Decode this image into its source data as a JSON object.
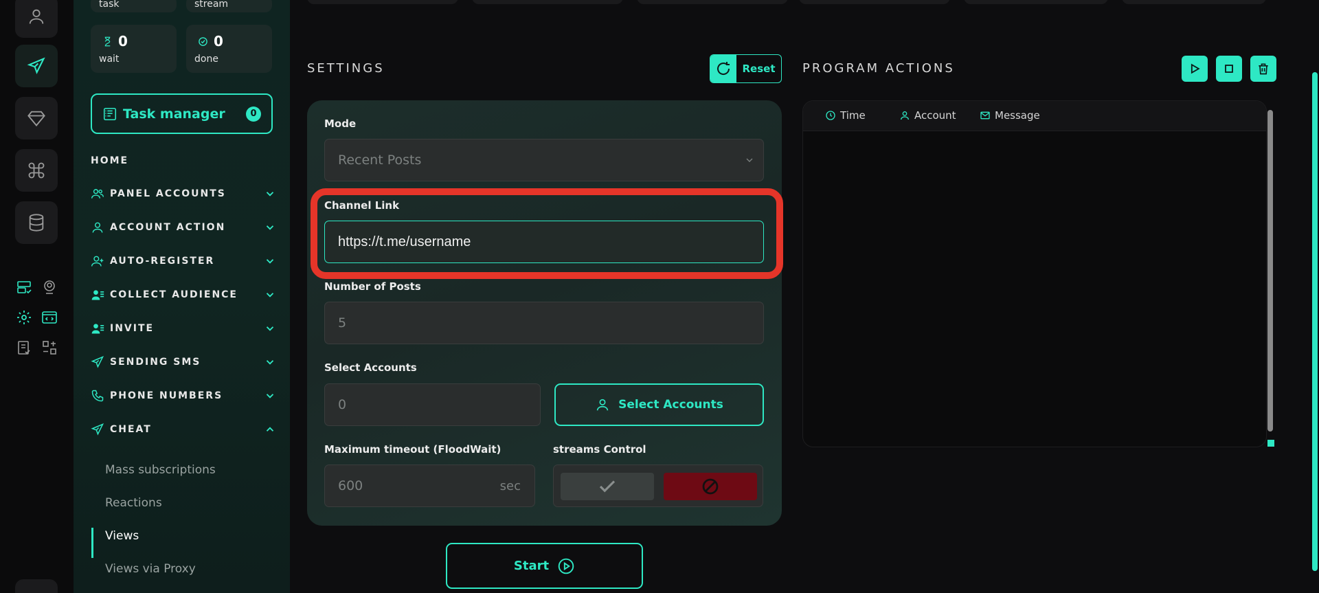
{
  "stats": {
    "task_label": "task",
    "stream_label": "stream",
    "wait_value": "0",
    "wait_label": "wait",
    "done_value": "0",
    "done_label": "done"
  },
  "task_manager": {
    "label": "Task manager",
    "count": "0"
  },
  "nav": {
    "home": "HOME",
    "items": [
      {
        "label": "PANEL ACCOUNTS",
        "icon": "users-icon",
        "expanded": false
      },
      {
        "label": "ACCOUNT ACTION",
        "icon": "user-icon",
        "expanded": false
      },
      {
        "label": "AUTO-REGISTER",
        "icon": "user-plus-icon",
        "expanded": false
      },
      {
        "label": "COLLECT AUDIENCE",
        "icon": "user-list-icon",
        "expanded": false
      },
      {
        "label": "INVITE",
        "icon": "user-list-icon",
        "expanded": false
      },
      {
        "label": "SENDING SMS",
        "icon": "send-icon",
        "expanded": false
      },
      {
        "label": "PHONE NUMBERS",
        "icon": "phone-icon",
        "expanded": false
      },
      {
        "label": "CHEAT",
        "icon": "send-icon",
        "expanded": true
      }
    ],
    "cheat_subitems": [
      "Mass subscriptions",
      "Reactions",
      "Views",
      "Views via Proxy"
    ],
    "active_subitem": "Views"
  },
  "settings": {
    "title": "SETTINGS",
    "reset_label": "Reset",
    "mode_label": "Mode",
    "mode_value": "Recent Posts",
    "channel_link_label": "Channel Link",
    "channel_link_value": "https://t.me/username",
    "posts_label": "Number of Posts",
    "posts_placeholder": "5",
    "select_accounts_label": "Select Accounts",
    "accounts_count_placeholder": "0",
    "select_accounts_button": "Select Accounts",
    "timeout_label": "Maximum timeout (FloodWait)",
    "timeout_placeholder": "600",
    "timeout_unit": "sec",
    "streams_label": "streams Control",
    "start_label": "Start"
  },
  "program_actions": {
    "title": "PROGRAM ACTIONS",
    "columns": [
      "Time",
      "Account",
      "Message"
    ]
  },
  "colors": {
    "accent": "#2ee8c4",
    "highlight": "#e53529",
    "danger": "#6e0a14",
    "background": "#0d0d0f"
  }
}
